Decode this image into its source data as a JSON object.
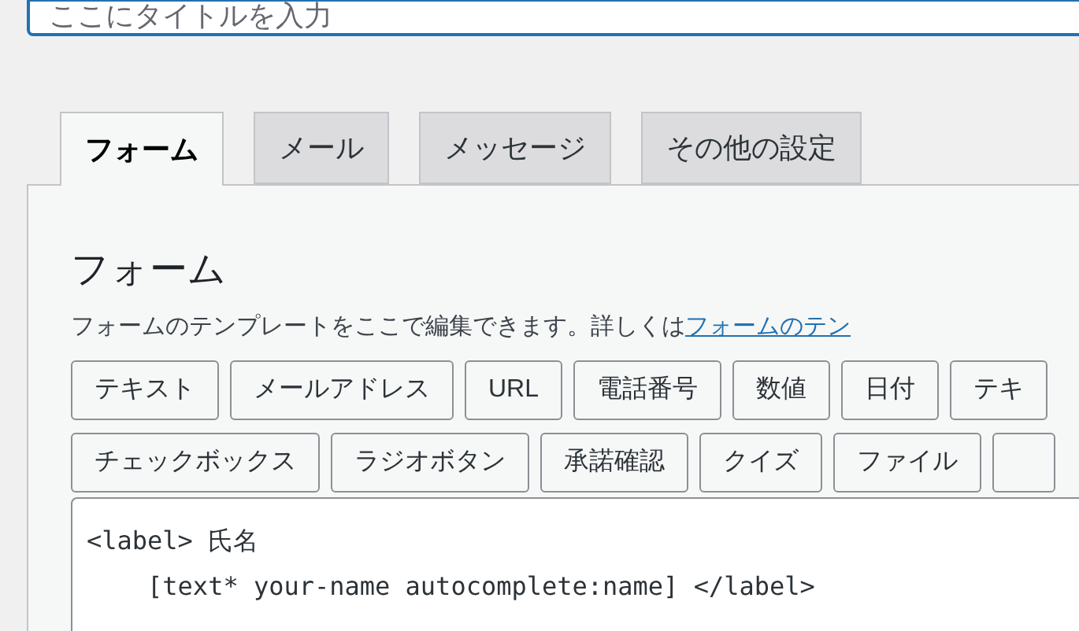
{
  "title_field": {
    "placeholder": "ここにタイトルを入力"
  },
  "tabs": [
    {
      "label": "フォーム",
      "selected": true
    },
    {
      "label": "メール",
      "selected": false
    },
    {
      "label": "メッセージ",
      "selected": false
    },
    {
      "label": "その他の設定",
      "selected": false
    }
  ],
  "panel": {
    "heading": "フォーム",
    "description": "フォームのテンプレートをここで編集できます。詳しくは",
    "link": "フォームのテン",
    "tag_buttons": [
      [
        "テキスト",
        "メールアドレス",
        "URL",
        "電話番号",
        "数値",
        "日付",
        "テキ"
      ],
      [
        "チェックボックス",
        "ラジオボタン",
        "承諾確認",
        "クイズ",
        "ファイル"
      ]
    ],
    "template_lines": [
      "<label> 氏名",
      "    [text* your-name autocomplete:name] </label>"
    ]
  }
}
